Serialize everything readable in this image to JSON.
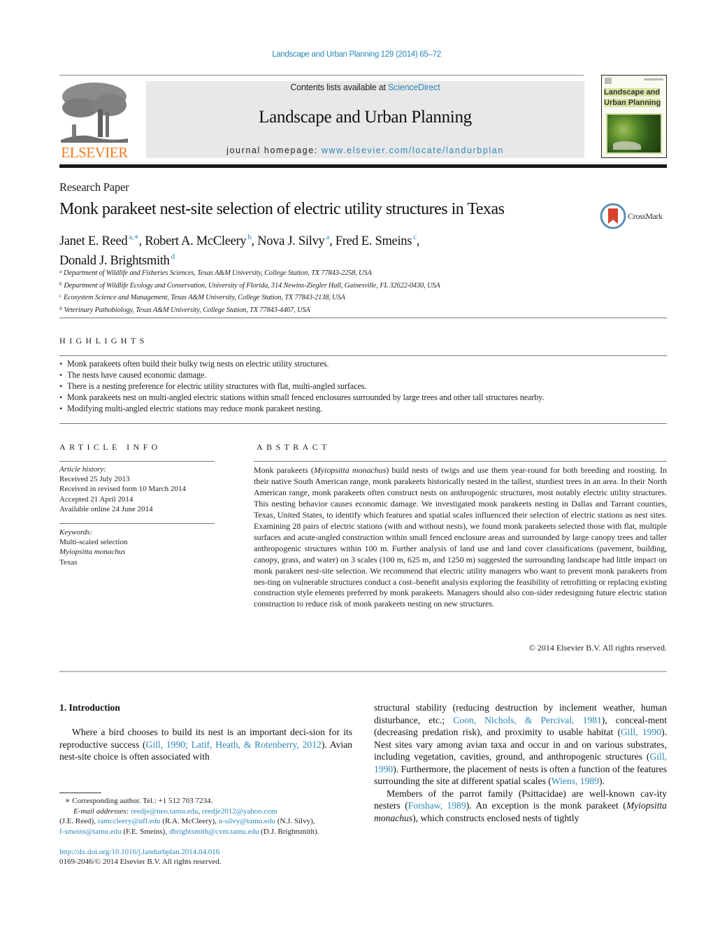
{
  "header": {
    "journal_ref": "Landscape and Urban Planning 129 (2014) 65–72",
    "contents_prefix": "Contents lists available at ",
    "contents_link": "ScienceDirect",
    "journal_title": "Landscape and Urban Planning",
    "homepage_prefix": "journal homepage: ",
    "homepage_link": "www.elsevier.com/locate/landurbplan",
    "publisher_logo": "ELSEVIER",
    "cover_title_line1": "Landscape and",
    "cover_title_line2": "Urban Planning",
    "crossmark_label": "CrossMark"
  },
  "article": {
    "type": "Research Paper",
    "title": "Monk parakeet nest-site selection of electric utility structures in Texas",
    "authors": [
      {
        "name": "Janet E. Reed",
        "sup": "a,∗",
        "sep": ", "
      },
      {
        "name": "Robert A. McCleery",
        "sup": "b",
        "sep": ", "
      },
      {
        "name": "Nova J. Silvy",
        "sup": "a",
        "sep": ", "
      },
      {
        "name": "Fred E. Smeins",
        "sup": "c",
        "sep": ","
      },
      {
        "name": "Donald J. Brightsmith",
        "sup": "d",
        "sep": ""
      }
    ],
    "affiliations": [
      {
        "key": "a",
        "text": "Department of Wildlife and Fisheries Sciences, Texas A&M University, College Station, TX 77843-2258, USA"
      },
      {
        "key": "b",
        "text": "Department of Wildlife Ecology and Conservation, University of Florida, 314 Newins-Ziegler Hall, Gainesville, FL 32622-0430, USA"
      },
      {
        "key": "c",
        "text": "Ecosystem Science and Management, Texas A&M University, College Station, TX 77843-2138, USA"
      },
      {
        "key": "d",
        "text": "Veterinary Pathobiology, Texas A&M University, College Station, TX 77843-4467, USA"
      }
    ]
  },
  "highlights": {
    "heading": "HIGHLIGHTS",
    "items": [
      "Monk parakeets often build their bulky twig nests on electric utility structures.",
      "The nests have caused economic damage.",
      "There is a nesting preference for electric utility structures with flat, multi-angled surfaces.",
      "Monk parakeets nest on multi-angled electric stations within small fenced enclosures surrounded by large trees and other tall structures nearby.",
      "Modifying multi-angled electric stations may reduce monk parakeet nesting."
    ]
  },
  "article_info": {
    "heading": "ARTICLE INFO",
    "history_label": "Article history:",
    "history": [
      "Received 25 July 2013",
      "Received in revised form 10 March 2014",
      "Accepted 21 April 2014",
      "Available online 24 June 2014"
    ],
    "keywords_label": "Keywords:",
    "keywords": [
      "Multi-scaled selection",
      "Myiopsitta monachus",
      "Texas"
    ]
  },
  "abstract": {
    "heading": "ABSTRACT",
    "part1": "Monk parakeets (",
    "species": "Myiopsitta monachus",
    "part2": ") build nests of twigs and use them year-round for both breeding and roosting. In their native South American range, monk parakeets historically nested in the tallest, sturdiest trees in an area. In their North American range, monk parakeets often construct nests on anthropogenic structures, most notably electric utility structures. This nesting behavior causes economic damage. We investigated monk parakeets nesting in Dallas and Tarrant counties, Texas, United States, to identify which features and spatial scales influenced their selection of electric stations as nest sites. Examining 28 pairs of electric stations (with and without nests), we found monk parakeets selected those with flat, multiple surfaces and acute-angled construction within small fenced enclosure areas and surrounded by large canopy trees and taller anthropogenic structures within 100 m. Further analysis of land use and land cover classifications (pavement, building, canopy, grass, and water) on 3 scales (100 m, 625 m, and 1250 m) suggested the surrounding landscape had little impact on monk parakeet nest-site selection. We recommend that electric utility managers who want to prevent monk parakeets from nes-ting on vulnerable structures conduct a cost–benefit analysis exploring the feasibility of retrofitting or replacing existing construction style elements preferred by monk parakeets. Managers should also con-sider redesigning future electric station construction to reduce risk of monk parakeets nesting on new structures.",
    "copyright": "© 2014 Elsevier B.V. All rights reserved."
  },
  "introduction": {
    "heading": "1.  Introduction",
    "left_p1_a": "Where a bird chooses to build its nest is an important deci-sion for its reproductive success (",
    "left_p1_cite": "Gill, 1990; Latif, Heath, & Rotenberry, 2012",
    "left_p1_b": "). Avian nest-site choice is often associated with",
    "right_p1_a": "structural stability (reducing destruction by inclement weather, human disturbance, etc.; ",
    "right_p1_cite1": "Coon, Nichols, & Percival, 1981",
    "right_p1_b": "), conceal-ment (decreasing predation risk), and proximity to usable habitat (",
    "right_p1_cite2": "Gill, 1990",
    "right_p1_c": "). Nest sites vary among avian taxa and occur in and on various substrates, including vegetation, cavities, ground, and anthropogenic structures (",
    "right_p1_cite3": "Gill, 1990",
    "right_p1_d": "). Furthermore, the placement of nests is often a function of the features surrounding the site at different spatial scales (",
    "right_p1_cite4": "Wiens, 1989",
    "right_p1_e": ").",
    "right_p2_a": "Members of the parrot family (Psittacidae) are well-known cav-ity nesters (",
    "right_p2_cite": "Forshaw, 1989",
    "right_p2_b": "). An exception is the monk parakeet (",
    "right_p2_species": "Myiopsitta monachus",
    "right_p2_c": "), which constructs enclosed nests of tightly"
  },
  "footnotes": {
    "corresponding": "∗  Corresponding author. Tel.: +1 512 703 7234.",
    "email_label": "E-mail addresses:",
    "emails": [
      {
        "address": "reedje@neo.tamu.edu",
        "who": ""
      },
      {
        "address": "reedje2012@yahoo.com",
        "who": "(J.E. Reed)"
      },
      {
        "address": "ramccleery@ufl.edu",
        "who": "(R.A. McCleery)"
      },
      {
        "address": "n-silvy@tamu.edu",
        "who": "(N.J. Silvy)"
      },
      {
        "address": "f-smeins@tamu.edu",
        "who": "(F.E. Smeins)"
      },
      {
        "address": "dbrightsmith@cvm.tamu.edu",
        "who": "(D.J. Brightsmith)."
      }
    ],
    "doi": "http://dx.doi.org/10.1016/j.landurbplan.2014.04.016",
    "issn": "0169-2046/© 2014 Elsevier B.V. All rights reserved."
  },
  "colors": {
    "link": "#2a87b8",
    "elsevier_orange": "#f07b1f",
    "banner_gray": "#e8e8e8",
    "crossmark_red": "#d9412e"
  }
}
